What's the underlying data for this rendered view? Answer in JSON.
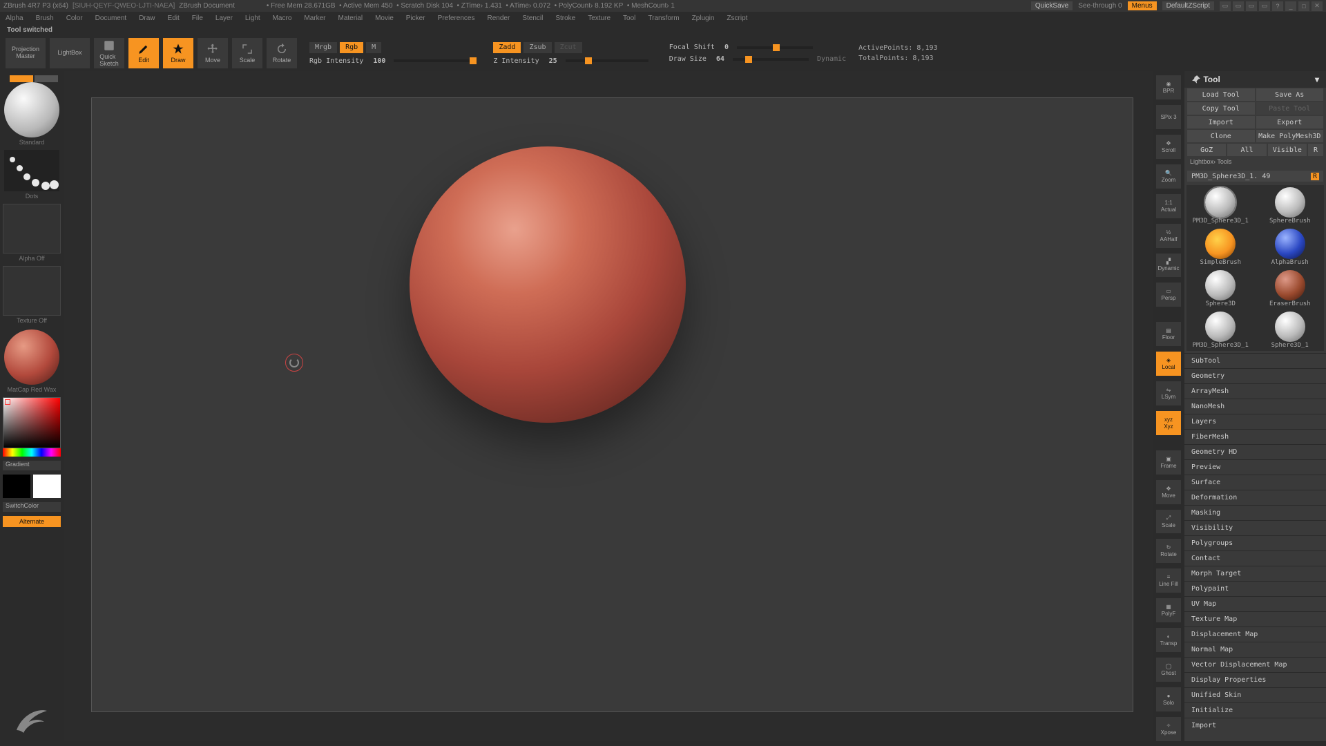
{
  "titlebar": {
    "app": "ZBrush 4R7 P3 (x64)",
    "sid": "[SIUH-QEYF-QWEO-LJTI-NAEA]",
    "doc": "ZBrush Document",
    "stats": [
      "Free Mem 28.671GB",
      "Active Mem 450",
      "Scratch Disk 104",
      "ZTime› 1.431",
      "ATime› 0.072",
      "PolyCount› 8.192 KP",
      "MeshCount› 1"
    ],
    "quicksave": "QuickSave",
    "seethrough": "See-through  0",
    "menus": "Menus",
    "script": "DefaultZScript"
  },
  "menus": [
    "Alpha",
    "Brush",
    "Color",
    "Document",
    "Draw",
    "Edit",
    "File",
    "Layer",
    "Light",
    "Macro",
    "Marker",
    "Material",
    "Movie",
    "Picker",
    "Preferences",
    "Render",
    "Stencil",
    "Stroke",
    "Texture",
    "Tool",
    "Transform",
    "Zplugin",
    "Zscript"
  ],
  "status": "Tool switched",
  "shelf": {
    "projection": "Projection\nMaster",
    "lightbox": "LightBox",
    "quicksketch": "Quick\nSketch",
    "edit": "Edit",
    "draw": "Draw",
    "move": "Move",
    "scale": "Scale",
    "rotate": "Rotate",
    "mrgb": "Mrgb",
    "rgb": "Rgb",
    "m": "M",
    "rgbint_label": "Rgb Intensity",
    "rgbint_val": "100",
    "zadd": "Zadd",
    "zsub": "Zsub",
    "zcut": "Zcut",
    "zint_label": "Z Intensity",
    "zint_val": "25",
    "focal_label": "Focal Shift",
    "focal_val": "0",
    "draw_label": "Draw Size",
    "draw_val": "64",
    "dynamic": "Dynamic",
    "active_pts": "ActivePoints: 8,193",
    "total_pts": "TotalPoints: 8,193"
  },
  "left": {
    "standard": "Standard",
    "dots": "Dots",
    "alpha": "Alpha Off",
    "texture": "Texture Off",
    "matcap": "MatCap Red Wax",
    "gradient": "Gradient",
    "switch": "SwitchColor",
    "alternate": "Alternate"
  },
  "viewbar": {
    "bpr": "BPR",
    "spix": "SPix 3",
    "scroll": "Scroll",
    "zoom": "Zoom",
    "actual": "Actual",
    "aahalf": "AAHalf",
    "persp": "Persp",
    "floor": "Floor",
    "local": "Local",
    "lsym": "LSym",
    "xyz": "Xyz",
    "frame": "Frame",
    "move": "Move",
    "scale": "Scale",
    "rotate": "Rotate",
    "linefill": "Line Fill",
    "polyf": "PolyF",
    "transp": "Transp",
    "ghost": "Ghost",
    "solo": "Solo",
    "xpose": "Xpose",
    "dynamic": "Dynamic"
  },
  "tool": {
    "header": "Tool",
    "rows": [
      [
        "Load Tool",
        "Save As"
      ],
      [
        "Copy Tool",
        "Paste Tool"
      ],
      [
        "Import",
        "Export"
      ],
      [
        "Clone",
        "Make PolyMesh3D"
      ],
      [
        "GoZ",
        "All",
        "Visible",
        "R"
      ]
    ],
    "lightbox": "Lightbox› Tools",
    "current": "PM3D_Sphere3D_1. 49",
    "palette": [
      {
        "name": "PM3D_Sphere3D_1",
        "bg": "radial-gradient(circle at 35% 30%,#fff,#bbb 55%,#666)"
      },
      {
        "name": "SphereBrush",
        "bg": "radial-gradient(circle at 35% 30%,#fff,#bbb 55%,#666)"
      },
      {
        "name": "SimpleBrush",
        "bg": "radial-gradient(circle at 40% 35%,#ffd24a,#f79421 55%,#7a3a00)"
      },
      {
        "name": "AlphaBrush",
        "bg": "radial-gradient(circle at 35% 30%,#9bb4ff,#2a47c2 55%,#0a1444)"
      },
      {
        "name": "Sphere3D",
        "bg": "radial-gradient(circle at 35% 30%,#fff,#bbb 55%,#666)"
      },
      {
        "name": "EraserBrush",
        "bg": "radial-gradient(circle at 35% 30%,#d98,#9a4a2e 55%,#3a170b)"
      },
      {
        "name": "PM3D_Sphere3D_1",
        "bg": "radial-gradient(circle at 35% 30%,#fff,#bbb 55%,#666)"
      },
      {
        "name": "Sphere3D_1",
        "bg": "radial-gradient(circle at 35% 30%,#fff,#bbb 55%,#666)"
      }
    ],
    "rollouts": [
      "SubTool",
      "Geometry",
      "ArrayMesh",
      "NanoMesh",
      "Layers",
      "FiberMesh",
      "Geometry HD",
      "Preview",
      "Surface",
      "Deformation",
      "Masking",
      "Visibility",
      "Polygroups",
      "Contact",
      "Morph Target",
      "Polypaint",
      "UV Map",
      "Texture Map",
      "Displacement Map",
      "Normal Map",
      "Vector Displacement Map",
      "Display Properties",
      "Unified Skin",
      "Initialize",
      "Import"
    ]
  }
}
